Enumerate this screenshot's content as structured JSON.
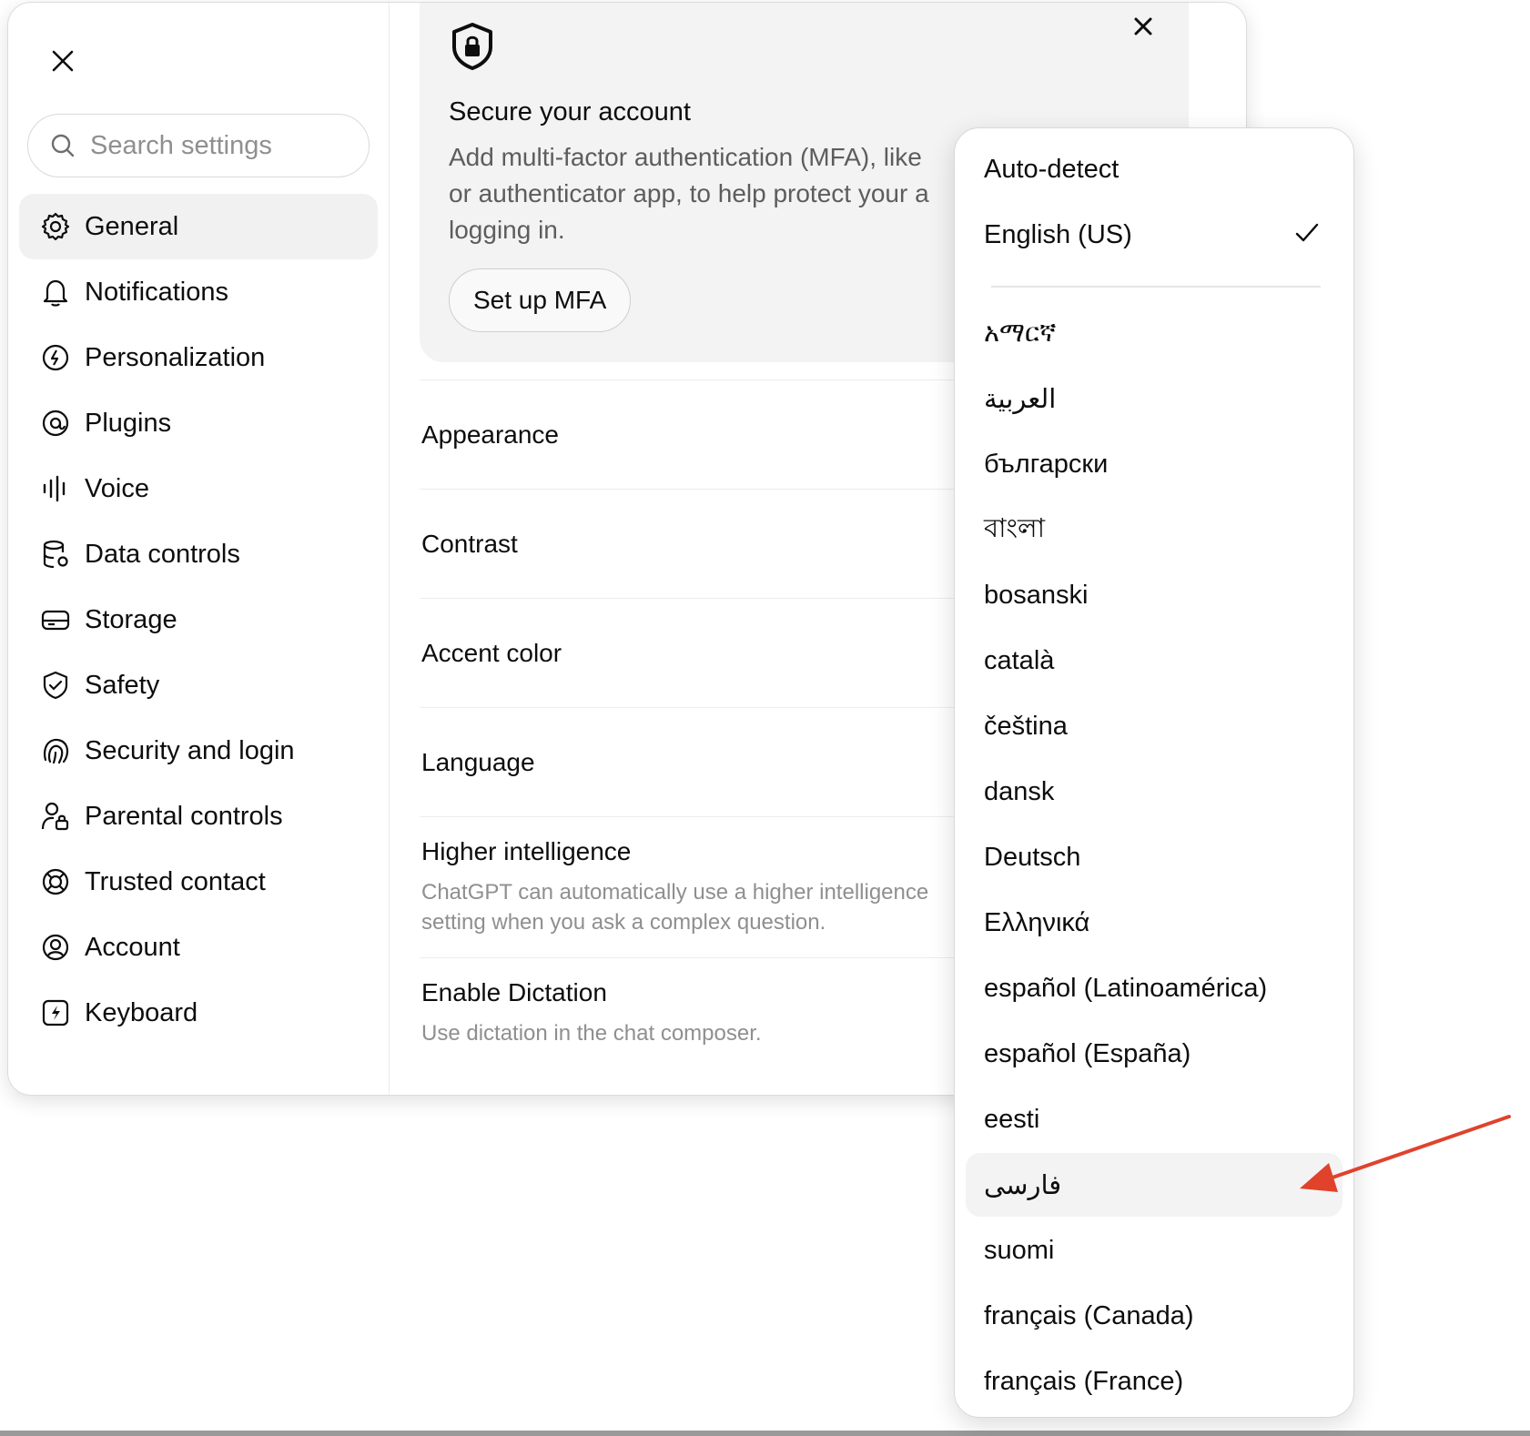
{
  "sidebar": {
    "search_placeholder": "Search settings",
    "items": [
      {
        "label": "General",
        "icon": "gear-icon",
        "active": true
      },
      {
        "label": "Notifications",
        "icon": "bell-icon"
      },
      {
        "label": "Personalization",
        "icon": "personalization-icon"
      },
      {
        "label": "Plugins",
        "icon": "plugins-icon"
      },
      {
        "label": "Voice",
        "icon": "waveform-icon"
      },
      {
        "label": "Data controls",
        "icon": "database-gear-icon"
      },
      {
        "label": "Storage",
        "icon": "drive-icon"
      },
      {
        "label": "Safety",
        "icon": "shield-check-icon"
      },
      {
        "label": "Security and login",
        "icon": "fingerprint-icon"
      },
      {
        "label": "Parental controls",
        "icon": "person-lock-icon"
      },
      {
        "label": "Trusted contact",
        "icon": "lifebuoy-icon"
      },
      {
        "label": "Account",
        "icon": "user-circle-icon"
      },
      {
        "label": "Keyboard",
        "icon": "bolt-square-icon"
      }
    ]
  },
  "mfa": {
    "title": "Secure your account",
    "description": "Add multi-factor authentication (MFA), like or authenticator app, to help protect your a logging in.",
    "description_lines": [
      "Add multi-factor authentication (MFA), like",
      "or authenticator app, to help protect your a",
      "logging in."
    ],
    "button": "Set up MFA"
  },
  "settings_rows": [
    {
      "title": "Appearance"
    },
    {
      "title": "Contrast"
    },
    {
      "title": "Accent color"
    },
    {
      "title": "Language"
    },
    {
      "title": "Higher intelligence",
      "desc_lines": [
        "ChatGPT can automatically use a higher intelligence",
        "setting when you ask a complex question."
      ]
    },
    {
      "title": "Enable Dictation",
      "desc_lines": [
        "Use dictation in the chat composer."
      ]
    }
  ],
  "language_dropdown": {
    "top_options": [
      {
        "label": "Auto-detect"
      },
      {
        "label": "English (US)",
        "selected": true
      }
    ],
    "options": [
      {
        "label": "አማርኛ"
      },
      {
        "label": "العربية"
      },
      {
        "label": "български"
      },
      {
        "label": "বাংলা"
      },
      {
        "label": "bosanski"
      },
      {
        "label": "català"
      },
      {
        "label": "čeština"
      },
      {
        "label": "dansk"
      },
      {
        "label": "Deutsch"
      },
      {
        "label": "Ελληνικά"
      },
      {
        "label": "español (Latinoamérica)"
      },
      {
        "label": "español (España)"
      },
      {
        "label": "eesti"
      },
      {
        "label": "فارسی",
        "highlighted": true
      },
      {
        "label": "suomi"
      },
      {
        "label": "français (Canada)"
      },
      {
        "label": "français (France)"
      }
    ]
  },
  "annotation": {
    "arrow_color": "#e0422c"
  }
}
